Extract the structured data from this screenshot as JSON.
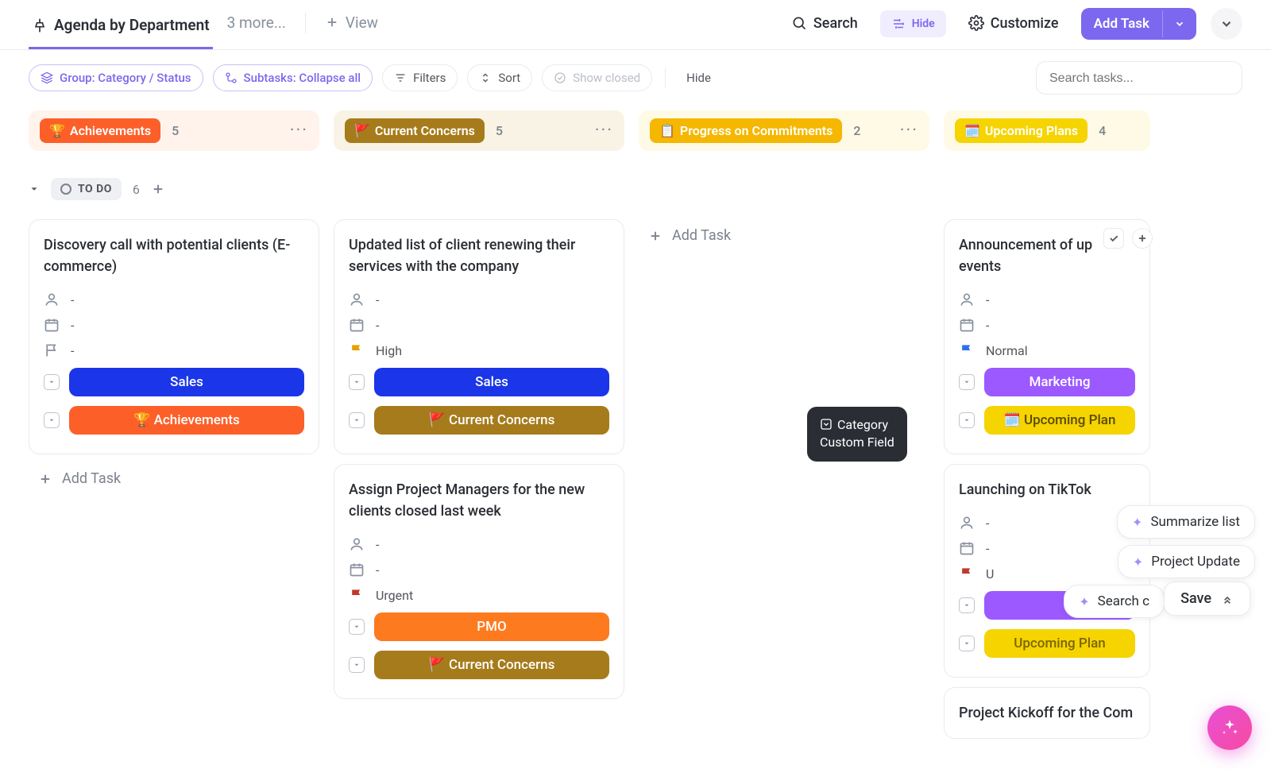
{
  "header": {
    "view_name": "Agenda by Department",
    "more": "3 more...",
    "add_view": "View",
    "search": "Search",
    "hide": "Hide",
    "customize": "Customize",
    "add_task": "Add Task"
  },
  "toolbar": {
    "group": "Group: Category / Status",
    "subtasks": "Subtasks: Collapse all",
    "filters": "Filters",
    "sort": "Sort",
    "show_closed": "Show closed",
    "hide": "Hide",
    "search_placeholder": "Search tasks..."
  },
  "columns": [
    {
      "emoji": "🏆",
      "label": "Achievements",
      "count": "5",
      "color": "#fd5f28"
    },
    {
      "emoji": "🚩",
      "label": "Current Concerns",
      "count": "5",
      "color": "#a67b1b"
    },
    {
      "emoji": "📋",
      "label": "Progress on Commitments",
      "count": "2",
      "color": "#f5b700"
    },
    {
      "emoji": "🗓️",
      "label": "Upcoming Plans",
      "count": "4",
      "color": "#f5d400"
    }
  ],
  "status": {
    "label": "TO DO",
    "count": "6"
  },
  "cards_col0": [
    {
      "title": "Discovery call with potential clients (E-commerce)",
      "assignee": "-",
      "date": "-",
      "priority": "-",
      "tag1": {
        "label": "Sales",
        "color": "#1a36e8"
      },
      "tag2": {
        "label": "🏆 Achievements",
        "color": "#fd5f28"
      }
    }
  ],
  "cards_col1": [
    {
      "title": "Updated list of client renewing their services with the company",
      "assignee": "-",
      "date": "-",
      "priority": "High",
      "priority_color": "#e6a100",
      "tag1": {
        "label": "Sales",
        "color": "#1a36e8"
      },
      "tag2": {
        "label": "🚩 Current Concerns",
        "color": "#a67b1b"
      }
    },
    {
      "title": "Assign Project Managers for the new clients closed last week",
      "assignee": "-",
      "date": "-",
      "priority": "Urgent",
      "priority_color": "#c0392b",
      "tag1": {
        "label": "PMO",
        "color": "#fd7a1f"
      },
      "tag2": {
        "label": "🚩 Current Concerns",
        "color": "#a67b1b"
      }
    }
  ],
  "cards_col3": [
    {
      "title": "Announcement of upcoming events",
      "title_short": "Announcement of up",
      "title_line2": "events",
      "assignee": "-",
      "date": "-",
      "priority": "Normal",
      "priority_color": "#2f6fed",
      "tag1": {
        "label": "Marketing",
        "color": "#9b59ff"
      },
      "tag2": {
        "label": "🗓️ Upcoming Plan",
        "color": "#f5d400"
      }
    },
    {
      "title": "Launching on TikTok",
      "assignee": "-",
      "date": "-",
      "priority": "U",
      "priority_color": "#c0392b",
      "tag1": {
        "label": "Upcoming Plan",
        "color": "#f5d400"
      }
    },
    {
      "title": "Project Kickoff for the Com"
    }
  ],
  "add_task_label": "Add Task",
  "tooltip": {
    "line1": "Category",
    "line2": "Custom Field"
  },
  "ai": {
    "summarize": "Summarize list",
    "project_update": "Project Update",
    "search": "Search c",
    "save": "Save"
  }
}
